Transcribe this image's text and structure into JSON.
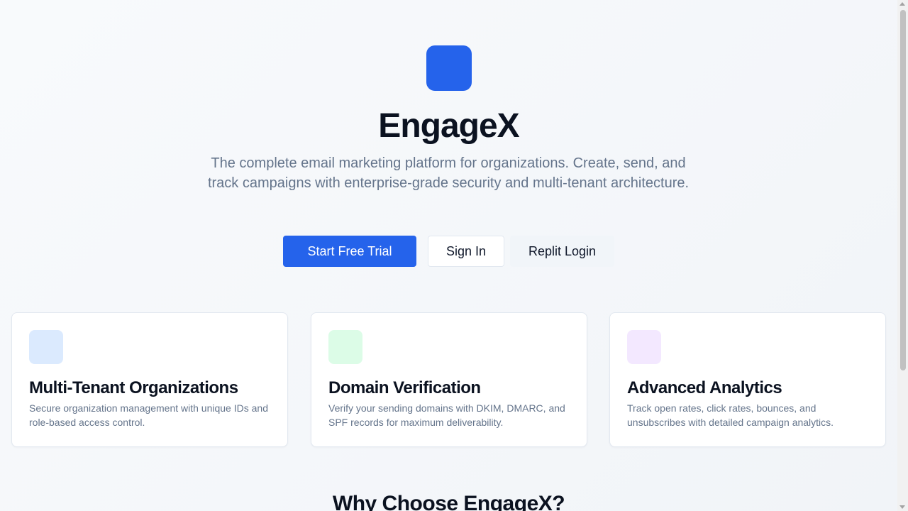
{
  "hero": {
    "logo_icon": "app-logo-square",
    "title": "EngageX",
    "tagline": "The complete email marketing platform for organizations. Create, send, and track campaigns with enterprise-grade security and multi-tenant architecture."
  },
  "actions": {
    "start_trial_label": "Start Free Trial",
    "sign_in_label": "Sign In",
    "replit_login_label": "Replit Login"
  },
  "features": [
    {
      "icon": "organizations-icon",
      "icon_bg": "#dbeafe",
      "title": "Multi-Tenant Organizations",
      "description": "Secure organization management with unique IDs and role-based access control."
    },
    {
      "icon": "domain-verification-icon",
      "icon_bg": "#dcfce7",
      "title": "Domain Verification",
      "description": "Verify your sending domains with DKIM, DMARC, and SPF records for maximum deliverability."
    },
    {
      "icon": "analytics-icon",
      "icon_bg": "#f3e8ff",
      "title": "Advanced Analytics",
      "description": "Track open rates, click rates, bounces, and unsubscribes with detailed campaign analytics."
    }
  ],
  "why_section": {
    "heading": "Why Choose EngageX?"
  },
  "colors": {
    "accent": "#2563eb",
    "muted_text": "#64748b"
  }
}
